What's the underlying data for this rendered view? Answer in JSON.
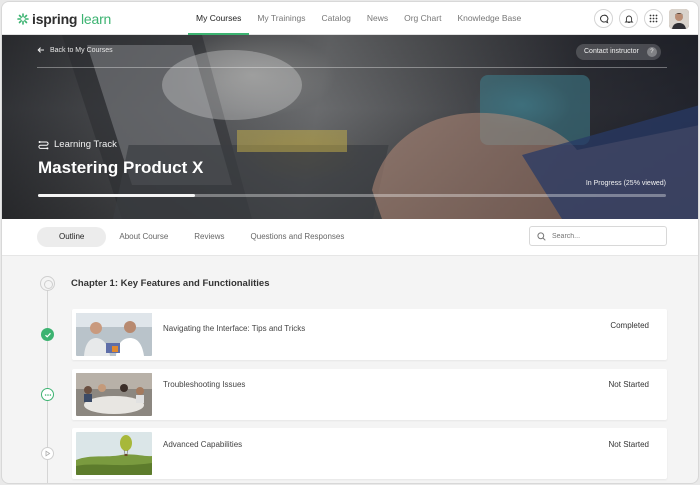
{
  "app": {
    "logo_word": "ispring",
    "logo_accent": "learn",
    "accent_color": "#3cb371"
  },
  "nav": {
    "items": [
      {
        "label": "My Courses",
        "active": true
      },
      {
        "label": "My Trainings"
      },
      {
        "label": "Catalog"
      },
      {
        "label": "News"
      },
      {
        "label": "Org Chart"
      },
      {
        "label": "Knowledge Base"
      }
    ]
  },
  "header_icons": [
    "chat-icon",
    "bell-icon",
    "apps-grid-icon",
    "avatar"
  ],
  "hero": {
    "back_label": "Back to My Courses",
    "contact_label": "Contact instructor",
    "contact_help": "?",
    "track_label": "Learning Track",
    "course_title": "Mastering Product X",
    "progress_text": "In Progress (25% viewed)",
    "progress_fraction": 0.25
  },
  "tabs": [
    {
      "label": "Outline",
      "active": true
    },
    {
      "label": "About Course"
    },
    {
      "label": "Reviews"
    },
    {
      "label": "Questions and Responses"
    }
  ],
  "search": {
    "placeholder": "Search..."
  },
  "chapter": {
    "title": "Chapter 1: Key Features and Functionalities",
    "lessons": [
      {
        "title": "Navigating the Interface: Tips and Tricks",
        "status": "Completed",
        "state": "completed"
      },
      {
        "title": "Troubleshooting Issues",
        "status": "Not Started",
        "state": "in-progress"
      },
      {
        "title": "Advanced Capabilities",
        "status": "Not Started",
        "state": "locked"
      }
    ]
  }
}
